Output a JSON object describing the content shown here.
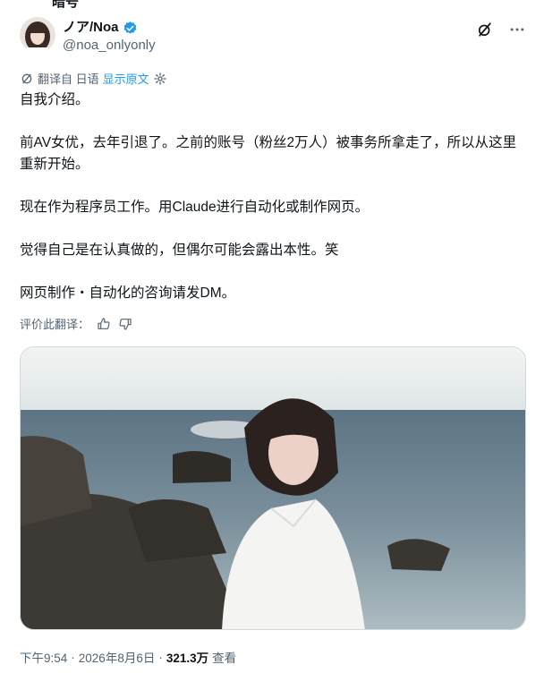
{
  "top_cut_text": "暗号",
  "author": {
    "display_name": "ノア/Noa",
    "handle": "@noa_onlyonly"
  },
  "translation_bar": {
    "translated_from": "翻译自 日语",
    "show_original": "显示原文"
  },
  "body": {
    "p1": "自我介绍。",
    "p2": "前AV女优，去年引退了。之前的账号（粉丝2万人）被事务所拿走了，所以从这里重新开始。",
    "p3": "现在作为程序员工作。用Claude进行自动化或制作网页。",
    "p4": "觉得自己是在认真做的，但偶尔可能会露出本性。笑",
    "p5": "网页制作・自动化的咨询请发DM。"
  },
  "rate_translation": "评价此翻译：",
  "footer": {
    "time": "下午9:54",
    "sep1": "·",
    "date": "2026年8月6日",
    "sep2": "·",
    "views_count": "321.3万",
    "views_label": "查看"
  },
  "colors": {
    "accent": "#1d9bf0",
    "text": "#0f1419",
    "secondary": "#536471"
  },
  "icons": [
    "verified-badge-icon",
    "grok-icon",
    "more-icon",
    "translate-icon",
    "gear-icon",
    "thumbs-up-icon",
    "thumbs-down-icon"
  ]
}
